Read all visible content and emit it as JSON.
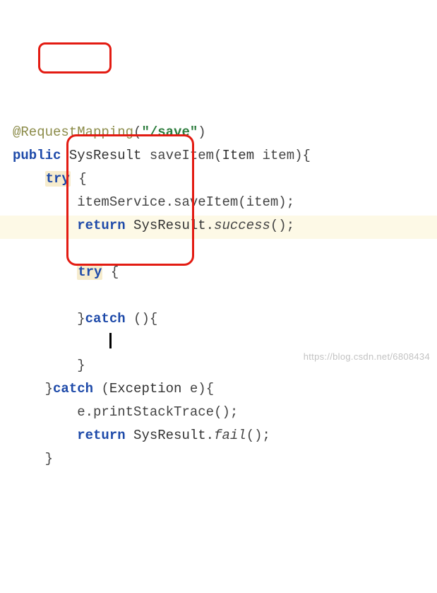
{
  "code": {
    "line1": {
      "annotation": "@RequestMapping",
      "paren_open": "(",
      "string": "\"/save\"",
      "paren_close": ")"
    },
    "line2": {
      "kw_public": "public",
      "type1": "SysResult",
      "method": "saveItem",
      "paren_open": "(",
      "type2": "Item",
      "param": "item",
      "paren_close": ")",
      "brace": "{"
    },
    "line3": {
      "kw_try": "try",
      "brace": "{"
    },
    "line4": {
      "obj": "itemService",
      "dot": ".",
      "call": "saveItem",
      "paren_open": "(",
      "arg": "item",
      "paren_close": ")",
      "semi": ";"
    },
    "line5": {
      "kw_return": "return",
      "type": "SysResult",
      "dot": ".",
      "call": "success",
      "parens": "()",
      "semi": ";"
    },
    "line6": "",
    "line7": {
      "kw_try": "try",
      "brace": "{"
    },
    "line8": "",
    "line9": {
      "brace_close": "}",
      "kw_catch": "catch",
      "parens": "()",
      "brace_open": "{"
    },
    "line10": "",
    "line11": {
      "brace_close": "}"
    },
    "line12": {
      "brace_close": "}",
      "kw_catch": "catch",
      "paren_open": "(",
      "etype": "Exception",
      "evar": "e",
      "paren_close": ")",
      "brace_open": "{"
    },
    "line13": {
      "obj": "e",
      "dot": ".",
      "call": "printStackTrace",
      "parens": "()",
      "semi": ";"
    },
    "line14": {
      "kw_return": "return",
      "type": "SysResult",
      "dot": ".",
      "call": "fail",
      "parens": "()",
      "semi": ";"
    },
    "line15": {
      "brace": "}"
    }
  },
  "watermark": "https://blog.csdn.net/6808434"
}
